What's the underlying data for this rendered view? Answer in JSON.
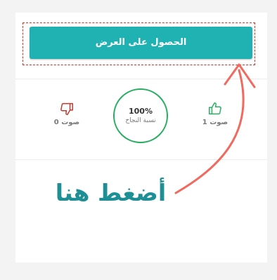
{
  "offer": {
    "button_label": "الحصول على العرض"
  },
  "votes": {
    "like_count": "1 صوت",
    "dislike_count": "0 صوت"
  },
  "success": {
    "percent": "100%",
    "label": "نسبة النجاح"
  },
  "annotation": {
    "text": "أضغط هنا"
  },
  "colors": {
    "button": "#20b2b2",
    "circle": "#27ae60",
    "dash": "#c0392b",
    "annotation_text": "#1f8f96",
    "arrow": "#f06a60"
  }
}
